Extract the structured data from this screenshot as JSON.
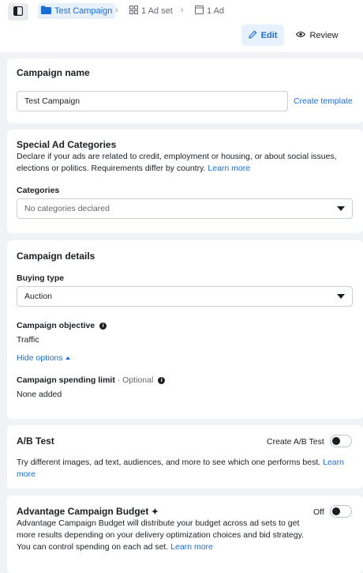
{
  "breadcrumb": {
    "campaign": "Test Campaign",
    "adset": "1 Ad set",
    "ad": "1 Ad"
  },
  "header": {
    "edit_label": "Edit",
    "review_label": "Review"
  },
  "campaign_name": {
    "title": "Campaign name",
    "value": "Test Campaign",
    "template_link": "Create template"
  },
  "special_ad": {
    "title": "Special Ad Categories",
    "description": "Declare if your ads are related to credit, employment or housing, or about social issues, elections or politics. Requirements differ by country.",
    "learn_more": "Learn more",
    "categories_label": "Categories",
    "categories_value": "No categories declared"
  },
  "campaign_details": {
    "title": "Campaign details",
    "buying_type_label": "Buying type",
    "buying_type_value": "Auction",
    "objective_label": "Campaign objective",
    "objective_value": "Traffic",
    "hide_options": "Hide options",
    "spending_limit_label": "Campaign spending limit",
    "optional_label": "· Optional",
    "spending_limit_value": "None added"
  },
  "ab_test": {
    "title": "A/B Test",
    "toggle_label": "Create A/B Test",
    "description": "Try different images, ad text, audiences, and more to see which one performs best.",
    "learn_more": "Learn more"
  },
  "advantage": {
    "title": "Advantage Campaign Budget",
    "toggle_label": "Off",
    "description": "Advantage Campaign Budget will distribute your budget across ad sets to get more results depending on your delivery optimization choices and bid strategy. You can control spending on each ad set.",
    "learn_more": "Learn more"
  },
  "colors": {
    "accent": "#1a6ed8",
    "background": "#f0f2f5"
  }
}
